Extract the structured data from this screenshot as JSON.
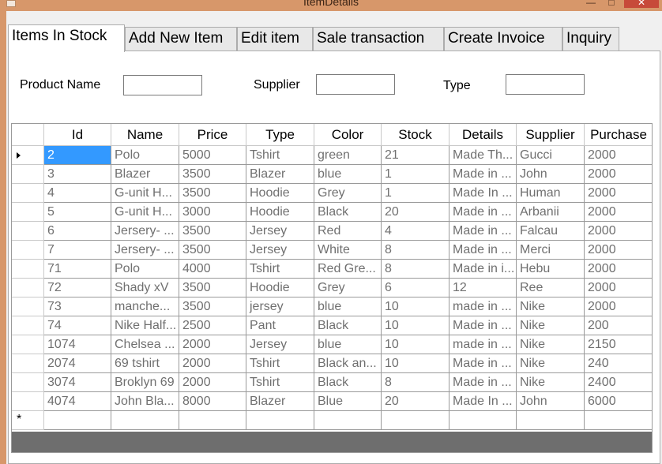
{
  "window": {
    "title": "ItemDetails",
    "minimize_label": "—",
    "maximize_label": "□",
    "close_label": "✕"
  },
  "tabs": [
    {
      "label": "Items In Stock",
      "active": true
    },
    {
      "label": "Add New Item",
      "active": false
    },
    {
      "label": "Edit item",
      "active": false
    },
    {
      "label": "Sale transaction",
      "active": false
    },
    {
      "label": "Create Invoice",
      "active": false
    },
    {
      "label": "Inquiry",
      "active": false
    }
  ],
  "filters": {
    "product_name_label": "Product Name",
    "product_name_value": "",
    "supplier_label": "Supplier",
    "supplier_value": "",
    "type_label": "Type",
    "type_value": ""
  },
  "grid": {
    "columns": [
      "Id",
      "Name",
      "Price",
      "Type",
      "Color",
      "Stock",
      "Details",
      "Supplier",
      "Purchase"
    ],
    "selected_row": 0,
    "selected_column": 0,
    "new_row_marker": "*",
    "rows": [
      [
        "2",
        "Polo",
        "5000",
        "Tshirt",
        "green",
        "21",
        "Made Th...",
        "Gucci",
        "2000"
      ],
      [
        "3",
        "Blazer",
        "3500",
        "Blazer",
        "blue",
        "1",
        "Made in ...",
        "John",
        "2000"
      ],
      [
        "4",
        "G-unit H...",
        "3500",
        "Hoodie",
        "Grey",
        "1",
        "Made In ...",
        "Human",
        "2000"
      ],
      [
        "5",
        "G-unit H...",
        "3000",
        "Hoodie",
        "Black",
        "20",
        "Made in ...",
        "Arbanii",
        "2000"
      ],
      [
        "6",
        "Jersery- ...",
        "3500",
        "Jersey",
        "Red",
        "4",
        "Made in ...",
        "Falcau",
        "2000"
      ],
      [
        "7",
        "Jersery- ...",
        "3500",
        "Jersey",
        "White",
        "8",
        "Made in ...",
        "Merci",
        "2000"
      ],
      [
        "71",
        "Polo",
        "4000",
        "Tshirt",
        "Red Gre...",
        "8",
        "Made in i...",
        "Hebu",
        "2000"
      ],
      [
        "72",
        "Shady xV",
        "3500",
        "Hoodie",
        "Grey",
        "6",
        "12",
        "Ree",
        "2000"
      ],
      [
        "73",
        "manche...",
        "3500",
        "jersey",
        "blue",
        "10",
        "made in ...",
        "Nike",
        "2000"
      ],
      [
        "74",
        "Nike Half...",
        "2500",
        "Pant",
        "Black",
        "10",
        "Made in ...",
        "Nike",
        "200"
      ],
      [
        "1074",
        "Chelsea ...",
        "2000",
        "Jersey",
        "blue",
        "10",
        "made in ...",
        "Nike",
        "2150"
      ],
      [
        "2074",
        "69 tshirt",
        "2000",
        "Tshirt",
        "Black an...",
        "10",
        "Made in ...",
        "Nike",
        "240"
      ],
      [
        "3074",
        "Broklyn 69",
        "2000",
        "Tshirt",
        "Black",
        "8",
        "Made in ...",
        "Nike",
        "2400"
      ],
      [
        "4074",
        "John Bla...",
        "8000",
        "Blazer",
        "Blue",
        "20",
        "Made In ...",
        "John",
        "6000"
      ]
    ]
  }
}
